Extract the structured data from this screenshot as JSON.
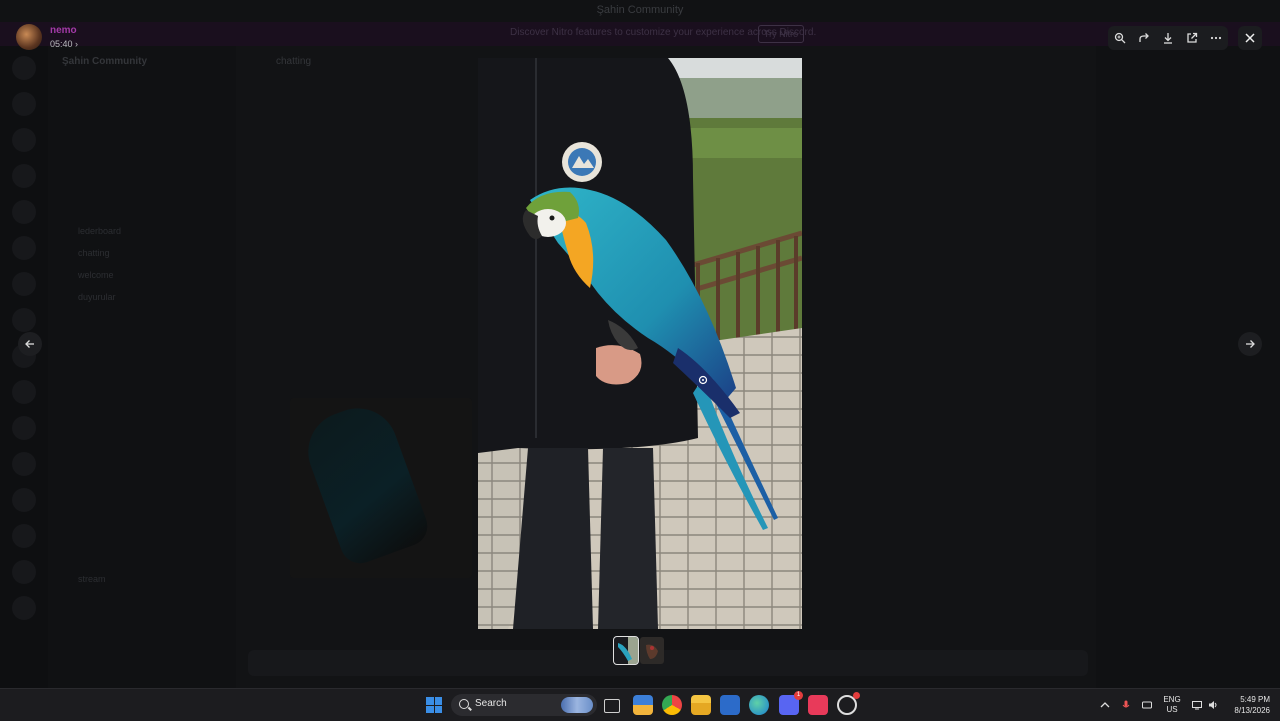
{
  "window": {
    "title": "Şahin Community"
  },
  "banner": {
    "text": "Discover Nitro features to customize your experience across Discord.",
    "button_label": "Try Nitro"
  },
  "background": {
    "server_name": "Şahin Community",
    "channels": [
      "lederboard",
      "chatting",
      "welcome",
      "duyurular",
      "stream"
    ],
    "chat_title": "chatting"
  },
  "viewer": {
    "uploader_name": "nemo",
    "timestamp": "05:40 ›",
    "toolbar": [
      {
        "icon": "zoom-in-icon"
      },
      {
        "icon": "forward-icon"
      },
      {
        "icon": "download-icon"
      },
      {
        "icon": "open-external-icon"
      },
      {
        "icon": "more-icon"
      }
    ],
    "close_icon": "close-icon",
    "prev_icon": "arrow-left-icon",
    "next_icon": "arrow-right-icon",
    "thumbnails": [
      {
        "name": "parrot-photo-1",
        "active": true
      },
      {
        "name": "parrot-photo-2",
        "active": false
      }
    ]
  },
  "taskbar": {
    "search_label": "Search",
    "apps": [
      {
        "name": "task-view-icon"
      },
      {
        "name": "microsoft-store-icon"
      },
      {
        "name": "chrome-icon"
      },
      {
        "name": "file-explorer-icon"
      },
      {
        "name": "mail-icon"
      },
      {
        "name": "edge-icon"
      },
      {
        "name": "discord-icon",
        "badge": "1"
      },
      {
        "name": "tiktok-icon"
      },
      {
        "name": "app-icon",
        "badge": ""
      }
    ],
    "language": "ENG",
    "region": "US",
    "time": "5:49 PM",
    "date": "8/13/2026"
  },
  "colors": {
    "accent": "#a33aa8",
    "taskbar_bg": "#1c1c1f",
    "windows_blue": "#3a8ee6"
  }
}
